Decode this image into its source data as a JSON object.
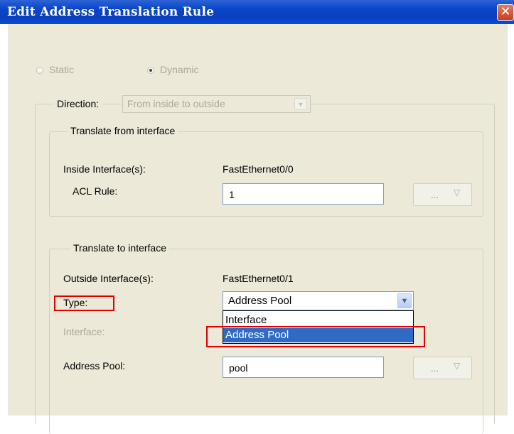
{
  "window": {
    "title": "Edit Address Translation Rule"
  },
  "mode": {
    "static_label": "Static",
    "dynamic_label": "Dynamic",
    "selected": "Dynamic"
  },
  "direction": {
    "label": "Direction:",
    "value": "From inside to outside"
  },
  "from_group": {
    "legend": "Translate from interface",
    "inside_label": "Inside Interface(s):",
    "inside_value": "FastEthernet0/0",
    "acl_label": "ACL Rule:",
    "acl_value": "1",
    "browse_label": "..."
  },
  "to_group": {
    "legend": "Translate to interface",
    "outside_label": "Outside Interface(s):",
    "outside_value": "FastEthernet0/1",
    "type_label": "Type:",
    "type_value": "Address Pool",
    "type_options": [
      "Interface",
      "Address Pool"
    ],
    "interface_label": "Interface:",
    "pool_label": "Address Pool:",
    "pool_value": "pool",
    "browse_label": "..."
  },
  "colors": {
    "highlight": "#e00000",
    "selection": "#316ac5",
    "titlebar": "#0a47c9"
  }
}
